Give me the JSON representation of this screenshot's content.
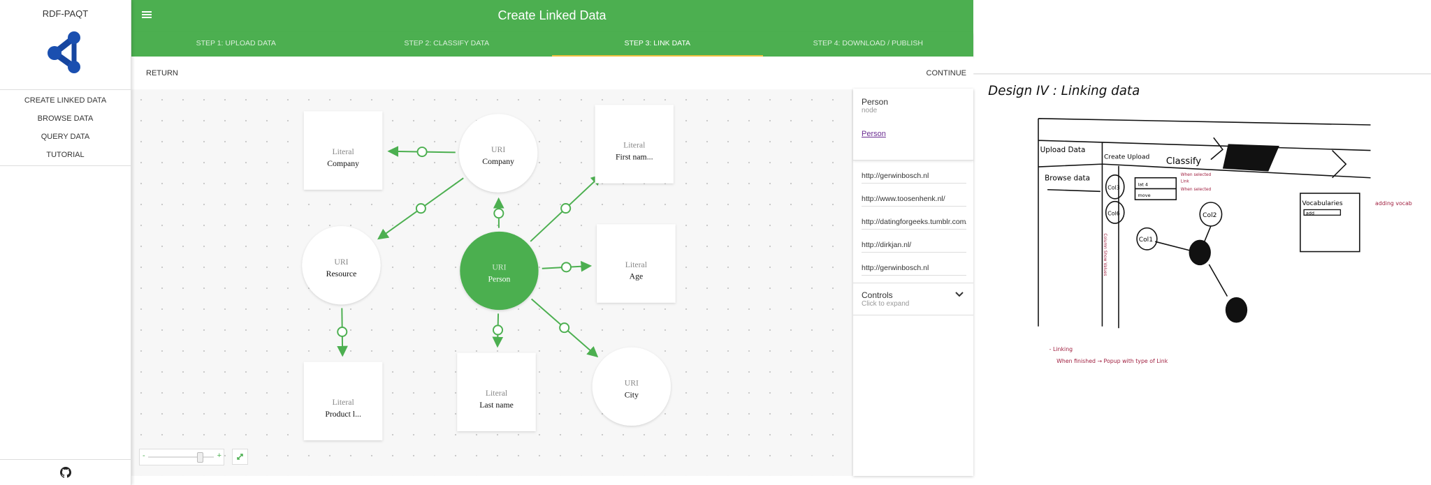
{
  "sidebar": {
    "brand": "RDF-PAQT",
    "items": [
      {
        "label": "CREATE LINKED DATA"
      },
      {
        "label": "BROWSE DATA"
      },
      {
        "label": "QUERY DATA"
      },
      {
        "label": "TUTORIAL"
      }
    ],
    "footer_icon": "github-icon"
  },
  "header": {
    "title": "Create Linked Data",
    "menu_icon": "hamburger-menu-icon"
  },
  "tabs": [
    {
      "label": "STEP 1: UPLOAD DATA"
    },
    {
      "label": "STEP 2: CLASSIFY DATA"
    },
    {
      "label": "STEP 3: LINK DATA",
      "active": true
    },
    {
      "label": "STEP 4: DOWNLOAD / PUBLISH"
    }
  ],
  "actions": {
    "return": "RETURN",
    "continue": "CONTINUE"
  },
  "colors": {
    "primary": "#4caf50",
    "tab_indicator": "#f0c040",
    "link": "#6a2c91"
  },
  "graph": {
    "nodes": [
      {
        "id": "lit-company",
        "type": "Literal",
        "label": "Company",
        "shape": "rect"
      },
      {
        "id": "uri-company",
        "type": "URI",
        "label": "Company",
        "shape": "circle"
      },
      {
        "id": "lit-firstname",
        "type": "Literal",
        "label": "First nam...",
        "shape": "rect"
      },
      {
        "id": "uri-resource",
        "type": "URI",
        "label": "Resource",
        "shape": "circle"
      },
      {
        "id": "uri-person",
        "type": "URI",
        "label": "Person",
        "shape": "circle",
        "selected": true
      },
      {
        "id": "lit-age",
        "type": "Literal",
        "label": "Age",
        "shape": "rect"
      },
      {
        "id": "lit-product",
        "type": "Literal",
        "label": "Product l...",
        "shape": "rect"
      },
      {
        "id": "lit-lastname",
        "type": "Literal",
        "label": "Last name",
        "shape": "rect"
      },
      {
        "id": "uri-city",
        "type": "URI",
        "label": "City",
        "shape": "circle"
      }
    ],
    "edges": [
      [
        "uri-company",
        "lit-company"
      ],
      [
        "uri-company",
        "uri-resource"
      ],
      [
        "uri-person",
        "uri-company"
      ],
      [
        "uri-person",
        "lit-firstname"
      ],
      [
        "uri-person",
        "lit-age"
      ],
      [
        "uri-resource",
        "lit-product"
      ],
      [
        "uri-person",
        "lit-lastname"
      ],
      [
        "uri-person",
        "uri-city"
      ]
    ],
    "zoom_slider": {
      "minus": "-",
      "plus": "+",
      "value_percent": 80
    }
  },
  "panel": {
    "title": "Person",
    "subtitle": "node",
    "link": "Person",
    "urls": [
      "http://gerwinbosch.nl",
      "http://www.toosenhenk.nl/",
      "http://datingforgeeks.tumblr.com/",
      "http://dirkjan.nl/",
      "http://gerwinbosch.nl"
    ],
    "controls_title": "Controls",
    "controls_subtitle": "Click to expand"
  },
  "sketch": {
    "title": "Design IV : Linking data",
    "labels": {
      "upload": "Upload Data",
      "create": "Create Upload",
      "classify": "Classify",
      "browse": "Browse data",
      "col3": "Col3",
      "col6": "Col6",
      "col1": "Col1",
      "col2": "Col2",
      "vocab": "Vocabularies",
      "add": "add",
      "adding": "adding vocab",
      "menu1": "lat 4",
      "menu2": "move",
      "note1": "When selected",
      "note2": "Link",
      "note3": "When selected",
      "col_note": "Column Show Values",
      "footer1": "- Linking",
      "footer2": "When finished → Popup with type of Link"
    }
  }
}
